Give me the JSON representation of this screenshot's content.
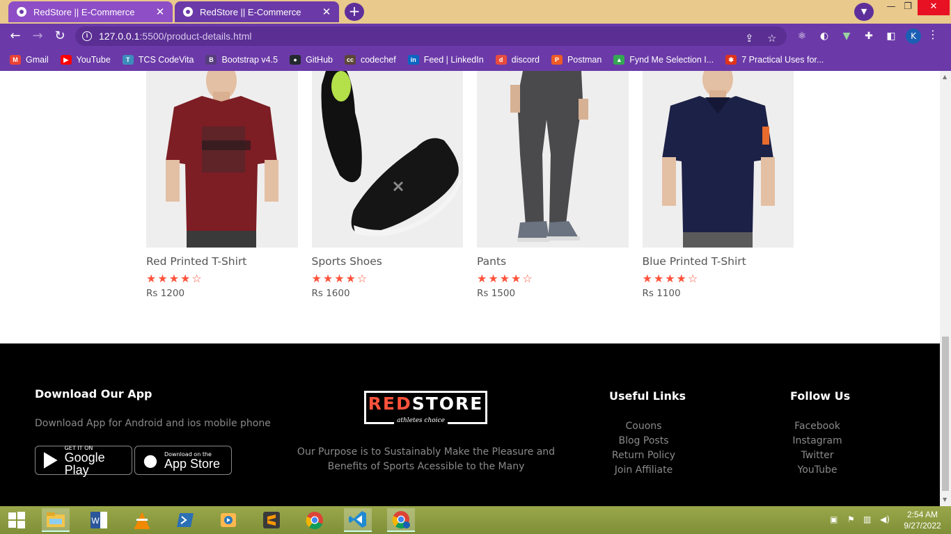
{
  "browser": {
    "tabs": [
      {
        "title": "RedStore || E-Commerce"
      },
      {
        "title": "RedStore || E-Commerce"
      }
    ],
    "url_host": "127.0.0.1",
    "url_path": ":5500/product-details.html",
    "profile_initial": "K",
    "bookmarks": [
      {
        "label": "Gmail",
        "icon": "gmail-icon",
        "color": "#ea4335",
        "glyph": "M"
      },
      {
        "label": "YouTube",
        "icon": "youtube-icon",
        "color": "#ff0000",
        "glyph": "▶"
      },
      {
        "label": "TCS CodeVita",
        "icon": "codevita-icon",
        "color": "#3c8dbc",
        "glyph": "T"
      },
      {
        "label": "Bootstrap v4.5",
        "icon": "bootstrap-icon",
        "color": "#563d7c",
        "glyph": "B"
      },
      {
        "label": "GitHub",
        "icon": "github-icon",
        "color": "#24292e",
        "glyph": "●"
      },
      {
        "label": "codechef",
        "icon": "codechef-icon",
        "color": "#5b4638",
        "glyph": "cc"
      },
      {
        "label": "Feed | LinkedIn",
        "icon": "linkedin-icon",
        "color": "#0a66c2",
        "glyph": "in"
      },
      {
        "label": "discord",
        "icon": "discord-icon",
        "color": "#e84c3d",
        "glyph": "d"
      },
      {
        "label": "Postman",
        "icon": "postman-icon",
        "color": "#ef5b25",
        "glyph": "P"
      },
      {
        "label": "Fynd Me Selection I...",
        "icon": "google-drive-icon",
        "color": "#34a853",
        "glyph": "▲"
      },
      {
        "label": "7 Practical Uses for...",
        "icon": "star-burst-icon",
        "color": "#e0331b",
        "glyph": "✱"
      }
    ]
  },
  "products": [
    {
      "name": "Red Printed T-Shirt",
      "rating": 4,
      "max_rating": 5,
      "price": "Rs 1200",
      "image": "red-tshirt-image"
    },
    {
      "name": "Sports Shoes",
      "rating": 4,
      "max_rating": 5,
      "price": "Rs 1600",
      "image": "sports-shoes-image"
    },
    {
      "name": "Pants",
      "rating": 4,
      "max_rating": 5,
      "price": "Rs 1500",
      "image": "pants-image"
    },
    {
      "name": "Blue Printed T-Shirt",
      "rating": 4,
      "max_rating": 5,
      "price": "Rs 1100",
      "image": "blue-tshirt-image"
    }
  ],
  "footer": {
    "download": {
      "heading": "Download Our App",
      "text": "Download App for Android and ios mobile phone",
      "google_play_small": "GET IT ON",
      "google_play_big": "Google Play",
      "app_store_small": "Download on the",
      "app_store_big": "App Store"
    },
    "logo": {
      "red": "RED",
      "white": "STORE",
      "tagline": "athletes choice"
    },
    "purpose": "Our Purpose is to Sustainably Make the Pleasure and Benefits of Sports Acessible to the Many",
    "useful_links": {
      "heading": "Useful Links",
      "items": [
        "Couons",
        "Blog Posts",
        "Return Policy",
        "Join Affiliate"
      ]
    },
    "follow_us": {
      "heading": "Follow Us",
      "items": [
        "Facebook",
        "Instagram",
        "Twitter",
        "YouTube"
      ]
    }
  },
  "taskbar": {
    "time": "2:54 AM",
    "date": "9/27/2022"
  },
  "colors": {
    "accent": "#ff523b",
    "browser_frame": "#6b3aa8",
    "tab_bar": "#e9c98c"
  }
}
